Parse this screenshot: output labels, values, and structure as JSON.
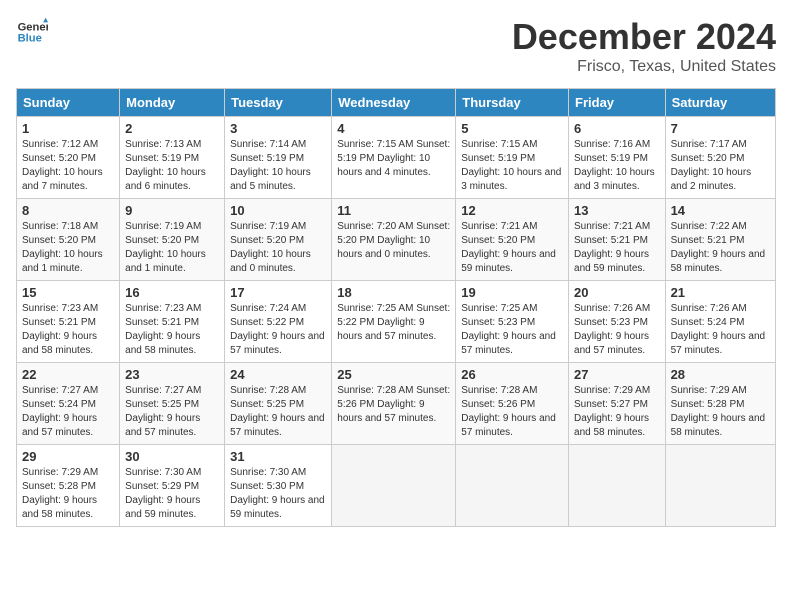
{
  "header": {
    "logo_line1": "General",
    "logo_line2": "Blue",
    "title": "December 2024",
    "subtitle": "Frisco, Texas, United States"
  },
  "days_of_week": [
    "Sunday",
    "Monday",
    "Tuesday",
    "Wednesday",
    "Thursday",
    "Friday",
    "Saturday"
  ],
  "weeks": [
    [
      {
        "num": "1",
        "info": "Sunrise: 7:12 AM\nSunset: 5:20 PM\nDaylight: 10 hours\nand 7 minutes."
      },
      {
        "num": "2",
        "info": "Sunrise: 7:13 AM\nSunset: 5:19 PM\nDaylight: 10 hours\nand 6 minutes."
      },
      {
        "num": "3",
        "info": "Sunrise: 7:14 AM\nSunset: 5:19 PM\nDaylight: 10 hours\nand 5 minutes."
      },
      {
        "num": "4",
        "info": "Sunrise: 7:15 AM\nSunset: 5:19 PM\nDaylight: 10 hours\nand 4 minutes."
      },
      {
        "num": "5",
        "info": "Sunrise: 7:15 AM\nSunset: 5:19 PM\nDaylight: 10 hours\nand 3 minutes."
      },
      {
        "num": "6",
        "info": "Sunrise: 7:16 AM\nSunset: 5:19 PM\nDaylight: 10 hours\nand 3 minutes."
      },
      {
        "num": "7",
        "info": "Sunrise: 7:17 AM\nSunset: 5:20 PM\nDaylight: 10 hours\nand 2 minutes."
      }
    ],
    [
      {
        "num": "8",
        "info": "Sunrise: 7:18 AM\nSunset: 5:20 PM\nDaylight: 10 hours\nand 1 minute."
      },
      {
        "num": "9",
        "info": "Sunrise: 7:19 AM\nSunset: 5:20 PM\nDaylight: 10 hours\nand 1 minute."
      },
      {
        "num": "10",
        "info": "Sunrise: 7:19 AM\nSunset: 5:20 PM\nDaylight: 10 hours\nand 0 minutes."
      },
      {
        "num": "11",
        "info": "Sunrise: 7:20 AM\nSunset: 5:20 PM\nDaylight: 10 hours\nand 0 minutes."
      },
      {
        "num": "12",
        "info": "Sunrise: 7:21 AM\nSunset: 5:20 PM\nDaylight: 9 hours\nand 59 minutes."
      },
      {
        "num": "13",
        "info": "Sunrise: 7:21 AM\nSunset: 5:21 PM\nDaylight: 9 hours\nand 59 minutes."
      },
      {
        "num": "14",
        "info": "Sunrise: 7:22 AM\nSunset: 5:21 PM\nDaylight: 9 hours\nand 58 minutes."
      }
    ],
    [
      {
        "num": "15",
        "info": "Sunrise: 7:23 AM\nSunset: 5:21 PM\nDaylight: 9 hours\nand 58 minutes."
      },
      {
        "num": "16",
        "info": "Sunrise: 7:23 AM\nSunset: 5:21 PM\nDaylight: 9 hours\nand 58 minutes."
      },
      {
        "num": "17",
        "info": "Sunrise: 7:24 AM\nSunset: 5:22 PM\nDaylight: 9 hours\nand 57 minutes."
      },
      {
        "num": "18",
        "info": "Sunrise: 7:25 AM\nSunset: 5:22 PM\nDaylight: 9 hours\nand 57 minutes."
      },
      {
        "num": "19",
        "info": "Sunrise: 7:25 AM\nSunset: 5:23 PM\nDaylight: 9 hours\nand 57 minutes."
      },
      {
        "num": "20",
        "info": "Sunrise: 7:26 AM\nSunset: 5:23 PM\nDaylight: 9 hours\nand 57 minutes."
      },
      {
        "num": "21",
        "info": "Sunrise: 7:26 AM\nSunset: 5:24 PM\nDaylight: 9 hours\nand 57 minutes."
      }
    ],
    [
      {
        "num": "22",
        "info": "Sunrise: 7:27 AM\nSunset: 5:24 PM\nDaylight: 9 hours\nand 57 minutes."
      },
      {
        "num": "23",
        "info": "Sunrise: 7:27 AM\nSunset: 5:25 PM\nDaylight: 9 hours\nand 57 minutes."
      },
      {
        "num": "24",
        "info": "Sunrise: 7:28 AM\nSunset: 5:25 PM\nDaylight: 9 hours\nand 57 minutes."
      },
      {
        "num": "25",
        "info": "Sunrise: 7:28 AM\nSunset: 5:26 PM\nDaylight: 9 hours\nand 57 minutes."
      },
      {
        "num": "26",
        "info": "Sunrise: 7:28 AM\nSunset: 5:26 PM\nDaylight: 9 hours\nand 57 minutes."
      },
      {
        "num": "27",
        "info": "Sunrise: 7:29 AM\nSunset: 5:27 PM\nDaylight: 9 hours\nand 58 minutes."
      },
      {
        "num": "28",
        "info": "Sunrise: 7:29 AM\nSunset: 5:28 PM\nDaylight: 9 hours\nand 58 minutes."
      }
    ],
    [
      {
        "num": "29",
        "info": "Sunrise: 7:29 AM\nSunset: 5:28 PM\nDaylight: 9 hours\nand 58 minutes."
      },
      {
        "num": "30",
        "info": "Sunrise: 7:30 AM\nSunset: 5:29 PM\nDaylight: 9 hours\nand 59 minutes."
      },
      {
        "num": "31",
        "info": "Sunrise: 7:30 AM\nSunset: 5:30 PM\nDaylight: 9 hours\nand 59 minutes."
      },
      null,
      null,
      null,
      null
    ]
  ]
}
